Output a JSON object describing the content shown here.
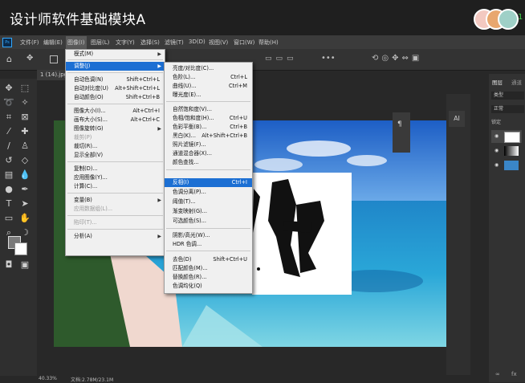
{
  "course": {
    "title": "设计师软件基础模块A"
  },
  "menubar": {
    "ps_logo": "Ps",
    "items": [
      "文件(F)",
      "编辑(E)",
      "图像(I)",
      "图层(L)",
      "文字(Y)",
      "选择(S)",
      "滤镜(T)",
      "3D(D)",
      "视图(V)",
      "窗口(W)",
      "帮助(H)"
    ]
  },
  "document": {
    "tab": "1 (14).jpg"
  },
  "image_menu": {
    "items": [
      {
        "label": "模式(M)",
        "shortcut": "",
        "submenu": true
      },
      {
        "label": "调整(J)",
        "shortcut": "",
        "submenu": true,
        "selected": true
      },
      {
        "label": "自动色调(N)",
        "shortcut": "Shift+Ctrl+L"
      },
      {
        "label": "自动对比度(U)",
        "shortcut": "Alt+Shift+Ctrl+L"
      },
      {
        "label": "自动颜色(O)",
        "shortcut": "Shift+Ctrl+B"
      },
      {
        "label": "图像大小(I)...",
        "shortcut": "Alt+Ctrl+I"
      },
      {
        "label": "画布大小(S)...",
        "shortcut": "Alt+Ctrl+C"
      },
      {
        "label": "图像旋转(G)",
        "shortcut": "",
        "submenu": true
      },
      {
        "label": "裁剪(P)",
        "shortcut": "",
        "disabled": true
      },
      {
        "label": "裁切(R)...",
        "shortcut": ""
      },
      {
        "label": "显示全部(V)",
        "shortcut": ""
      },
      {
        "label": "复制(D)...",
        "shortcut": ""
      },
      {
        "label": "应用图像(Y)...",
        "shortcut": ""
      },
      {
        "label": "计算(C)...",
        "shortcut": ""
      },
      {
        "label": "变量(B)",
        "shortcut": "",
        "submenu": true
      },
      {
        "label": "应用数据组(L)...",
        "shortcut": "",
        "disabled": true
      },
      {
        "label": "陷印(T)...",
        "shortcut": "",
        "disabled": true
      },
      {
        "label": "分析(A)",
        "shortcut": "",
        "submenu": true
      }
    ]
  },
  "adjust_menu": {
    "items": [
      {
        "label": "亮度/对比度(C)...",
        "shortcut": ""
      },
      {
        "label": "色阶(L)...",
        "shortcut": "Ctrl+L"
      },
      {
        "label": "曲线(U)...",
        "shortcut": "Ctrl+M"
      },
      {
        "label": "曝光度(E)...",
        "shortcut": ""
      },
      {
        "label": "自然饱和度(V)...",
        "shortcut": ""
      },
      {
        "label": "色相/饱和度(H)...",
        "shortcut": "Ctrl+U"
      },
      {
        "label": "色彩平衡(B)...",
        "shortcut": "Ctrl+B"
      },
      {
        "label": "黑白(K)...",
        "shortcut": "Alt+Shift+Ctrl+B"
      },
      {
        "label": "照片滤镜(F)...",
        "shortcut": ""
      },
      {
        "label": "通道混合器(X)...",
        "shortcut": ""
      },
      {
        "label": "颜色查找...",
        "shortcut": ""
      },
      {
        "label": "反相(I)",
        "shortcut": "Ctrl+I",
        "selected": true
      },
      {
        "label": "色调分离(P)...",
        "shortcut": ""
      },
      {
        "label": "阈值(T)...",
        "shortcut": ""
      },
      {
        "label": "渐变映射(G)...",
        "shortcut": ""
      },
      {
        "label": "可选颜色(S)...",
        "shortcut": ""
      },
      {
        "label": "阴影/高光(W)...",
        "shortcut": ""
      },
      {
        "label": "HDR 色调...",
        "shortcut": ""
      },
      {
        "label": "去色(D)",
        "shortcut": "Shift+Ctrl+U"
      },
      {
        "label": "匹配颜色(M)...",
        "shortcut": ""
      },
      {
        "label": "替换颜色(R)...",
        "shortcut": ""
      },
      {
        "label": "色调均化(Q)",
        "shortcut": ""
      }
    ]
  },
  "layers_panel": {
    "tab1": "图层",
    "tab2": "通道",
    "filter": "类型",
    "blend": "正常",
    "lock": "锁定"
  },
  "status": {
    "zoom": "40.33%",
    "doc": "文档:2.78M/23.1M"
  },
  "float_panel": {
    "icon1": "¶",
    "icon2": "AI"
  }
}
